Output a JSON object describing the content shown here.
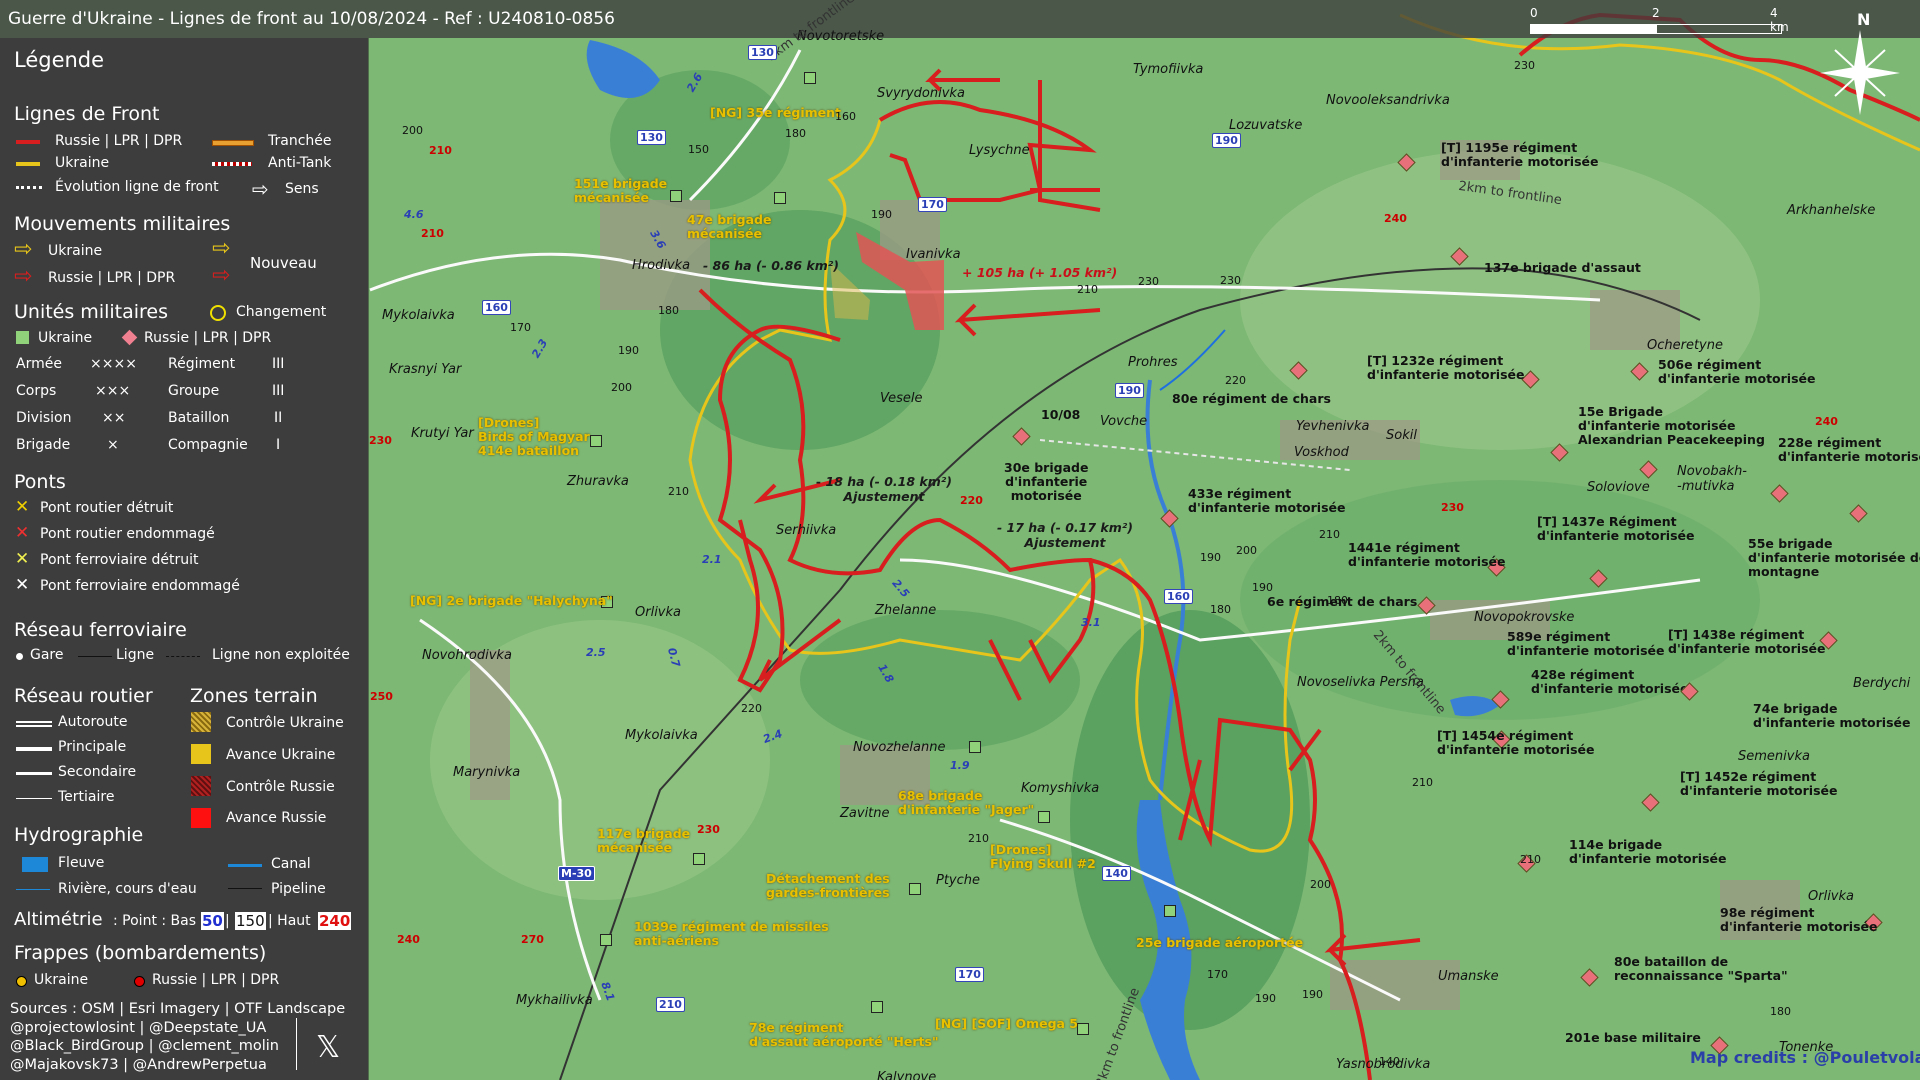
{
  "title": "Guerre d'Ukraine - Lignes de front au 10/08/2024 - Ref : U240810-0856",
  "scale": {
    "ticks": [
      "0",
      "2",
      "4 km"
    ]
  },
  "north": "N",
  "legend": {
    "heading": "Légende",
    "front_lines": {
      "heading": "Lignes de Front",
      "russia": "Russie | LPR | DPR",
      "ukraine": "Ukraine",
      "trench": "Tranchée",
      "antitank": "Anti-Tank",
      "evolution": "Évolution ligne de front",
      "direction": "Sens"
    },
    "movements": {
      "heading": "Mouvements militaires",
      "ukraine": "Ukraine",
      "russia": "Russie | LPR | DPR",
      "new": "Nouveau"
    },
    "units": {
      "heading": "Unités militaires",
      "change": "Changement",
      "ukraine": "Ukraine",
      "russia": "Russie | LPR | DPR",
      "rows": [
        {
          "label": "Armée",
          "sym": "××××",
          "label2": "Régiment",
          "sym2": "III"
        },
        {
          "label": "Corps",
          "sym": "×××",
          "label2": "Groupe",
          "sym2": "III"
        },
        {
          "label": "Division",
          "sym": "××",
          "label2": "Bataillon",
          "sym2": "II"
        },
        {
          "label": "Brigade",
          "sym": "×",
          "label2": "Compagnie",
          "sym2": "I"
        }
      ]
    },
    "bridges": {
      "heading": "Ponts",
      "items": [
        "Pont routier détruit",
        "Pont routier endommagé",
        "Pont ferroviaire détruit",
        "Pont ferroviaire endommagé"
      ]
    },
    "rail": {
      "heading": "Réseau ferroviaire",
      "station": "Gare",
      "line": "Ligne",
      "unused": "Ligne non exploitée"
    },
    "roads": {
      "heading": "Réseau routier",
      "items": [
        "Autoroute",
        "Principale",
        "Secondaire",
        "Tertiaire"
      ]
    },
    "terrain": {
      "heading": "Zones terrain",
      "items": [
        "Contrôle Ukraine",
        "Avance Ukraine",
        "Contrôle Russie",
        "Avance Russie"
      ]
    },
    "hydro": {
      "heading": "Hydrographie",
      "river": "Fleuve",
      "canal": "Canal",
      "stream": "Rivière, cours d'eau",
      "pipeline": "Pipeline"
    },
    "altimetry": {
      "label": "Altimétrie",
      "text": ": Point : Bas",
      "low": "50",
      "mid": "150",
      "high_label": "| Haut",
      "high": "240"
    },
    "strikes": {
      "heading": "Frappes (bombardements)",
      "ukraine": "Ukraine",
      "russia": "Russie | LPR | DPR"
    }
  },
  "sources": [
    "Sources : OSM | Esri Imagery | OTF Landscape",
    "@projectowlosint | @Deepstate_UA",
    "@Black_BirdGroup | @clement_molin",
    "@Majakovsk73 | @AndrewPerpetua"
  ],
  "credits": "Map credits : @Pouletvolant3",
  "places": [
    "Novotoretske",
    "Tymofiivka",
    "Svyrydonivka",
    "Lozuvatske",
    "Novooleksandrivka",
    "Lysychne",
    "Arkhanhelske",
    "Hrodivka",
    "Ivanivka",
    "Ocheretyne",
    "Mykolaivka",
    "Prohres",
    "Krasnyi Yar",
    "Vesele",
    "Krutyi Yar",
    "Vovche",
    "Yevhenivka",
    "Sokil",
    "Voskhod",
    "Zhuravka",
    "Soloviove",
    "Novobakh-\n-mutivka",
    "Serhiivka",
    "Orlivka",
    "Zhelanne",
    "Novohrodivka",
    "Novopokrovske",
    "Novoselivka Persha",
    "Berdychi",
    "Mykolaivka",
    "Novozhelanne",
    "Marynivka",
    "Semenivka",
    "Komyshivka",
    "Zavitne",
    "Orlivka",
    "Ptyche",
    "Umanske",
    "Mykhailivka",
    "Tonenke",
    "Yasnobrodivka",
    "Kalynove"
  ],
  "units_ru": [
    "[T] 1195e régiment\nd'infanterie motorisée",
    "137e brigade d'assaut",
    "[T] 1232e régiment\nd'infanterie motorisée",
    "506e régiment\nd'infanterie motorisée",
    "80e régiment de chars",
    "15e Brigade\nd'infanterie motorisée\nAlexandrian Peacekeeping",
    "228e régiment\nd'infanterie motorisée",
    "30e brigade\nd'infanterie\nmotorisée",
    "433e régiment\nd'infanterie motorisée",
    "[T] 1437e Régiment\nd'infanterie motorisée",
    "1441e régiment\nd'infanterie motorisée",
    "55e brigade\nd'infanterie motorisée de\nmontagne",
    "6e régiment de chars",
    "589e régiment\nd'infanterie motorisée",
    "[T] 1438e régiment\nd'infanterie motorisée",
    "428e régiment\nd'infanterie motorisée",
    "74e brigade\nd'infanterie motorisée",
    "[T] 1454e régiment\nd'infanterie motorisée",
    "[T] 1452e régiment\nd'infanterie motorisée",
    "114e brigade\nd'infanterie motorisée",
    "98e régiment\nd'infanterie motorisée",
    "80e bataillon de\nreconnaissance \"Sparta\"",
    "201e base militaire"
  ],
  "units_ua": [
    "[NG] 35e régiment",
    "151e brigade\nmécanisée",
    "47e brigade\nmécanisée",
    "[Drones]\nBirds of Magyar\n414e bataillon",
    "[NG] 2e brigade \"Halychyna\"",
    "68e brigade\nd'infanterie \"Jager\"",
    "[Drones]\nFlying Skull #2",
    "117e brigade\nmécanisée",
    "Détachement des\ngardes-frontières",
    "25e brigade aéroportée",
    "1039e régiment de missiles\nanti-aériens",
    "78e régiment\nd'assaut aéroporté \"Herts\"",
    "[NG] [SOF] Omega 5"
  ],
  "changes": [
    {
      "text": "- 86 ha (- 0.86 km²)",
      "color": "#1a1a1a"
    },
    {
      "text": "+ 105 ha (+ 1.05 km²)",
      "color": "#c8101a"
    },
    {
      "text": "- 18 ha (- 0.18 km²)\nAjustement",
      "color": "#1a1a1a"
    },
    {
      "text": "- 17 ha (- 0.17 km²)\nAjustement",
      "color": "#1a1a1a"
    }
  ],
  "date_marker": "10/08",
  "frontline_labels": [
    "2km to frontline",
    "2km to frontline",
    "2km to frontline",
    "2km to frontline"
  ],
  "roads": [
    "130",
    "130",
    "170",
    "160",
    "190",
    "190",
    "160",
    "140",
    "170",
    "210",
    "M-30",
    "2.6",
    "3.6",
    "4.6",
    "2.3",
    "2.1",
    "2.5",
    "1.8",
    "2.5",
    "0.7",
    "3.1",
    "2.4",
    "1.9",
    "8.1"
  ],
  "altitudes_red": [
    "210",
    "240",
    "210",
    "220",
    "230",
    "230",
    "240",
    "250",
    "240",
    "270",
    "230",
    "240"
  ],
  "altitudes": [
    "200",
    "150",
    "180",
    "160",
    "190",
    "210",
    "230",
    "230",
    "220",
    "170",
    "180",
    "190",
    "200",
    "210",
    "210",
    "190",
    "200",
    "180",
    "190",
    "180",
    "220",
    "210",
    "210",
    "200",
    "190",
    "170",
    "190",
    "210",
    "180",
    "230",
    "140",
    "210"
  ],
  "colors": {
    "russia": "#d81e1e",
    "ukraine": "#e8c51a",
    "legend_bg": "#3d3d3d",
    "map_green": "#6fae6a"
  }
}
